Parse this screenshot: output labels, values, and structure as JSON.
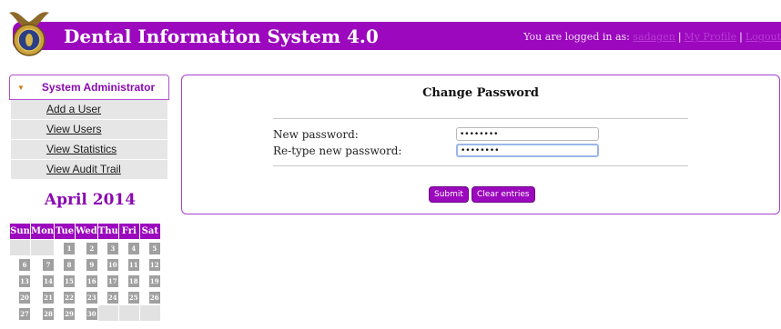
{
  "header": {
    "title": "Dental Information System 4.0",
    "login_prefix": "You are logged in as:",
    "username": "sadagen",
    "profile_link": "My Profile",
    "logout_link": "Logout",
    "separator": "|"
  },
  "sidebar": {
    "section_title": "System Administrator",
    "items": [
      {
        "label": "Add a User"
      },
      {
        "label": "View Users"
      },
      {
        "label": "View Statistics"
      },
      {
        "label": "View Audit Trail"
      }
    ]
  },
  "calendar": {
    "month_title": "April 2014",
    "weekdays": [
      "Sun",
      "Mon",
      "Tue",
      "Wed",
      "Thu",
      "Fri",
      "Sat"
    ],
    "weeks": [
      [
        "",
        "",
        "1",
        "2",
        "3",
        "4",
        "5"
      ],
      [
        "6",
        "7",
        "8",
        "9",
        "10",
        "11",
        "12"
      ],
      [
        "13",
        "14",
        "15",
        "16",
        "17",
        "18",
        "19"
      ],
      [
        "20",
        "21",
        "22",
        "23",
        "24",
        "25",
        "26"
      ],
      [
        "27",
        "28",
        "29",
        "30",
        "",
        "",
        ""
      ]
    ]
  },
  "form": {
    "title": "Change Password",
    "new_password_label": "New password:",
    "new_password_value": "••••••••",
    "retype_label": "Re-type new password:",
    "retype_value": "••••••••",
    "submit_label": "Submit",
    "clear_label": "Clear entries"
  },
  "colors": {
    "brand_purple": "#9b08bd",
    "link_purple": "#b83bd6",
    "menu_arrow": "#d07a1a"
  }
}
